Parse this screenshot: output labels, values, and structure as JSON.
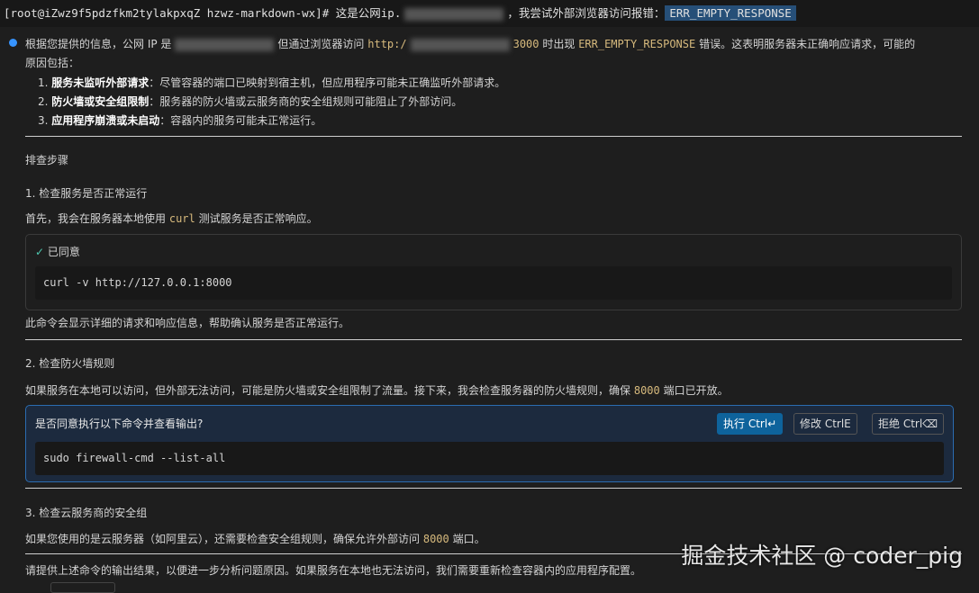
{
  "terminal": {
    "prompt": "[root@iZwz9f5pdzfkm2tylakpxqZ hzwz-markdown-wx]#",
    "text_a": "这是公网ip.",
    "text_b": "，我尝试外部浏览器访问报错：",
    "error": "ERR_EMPTY_RESPONSE"
  },
  "intro": {
    "a": "根据您提供的信息，公网 IP 是",
    "b": "但通过浏览器访问",
    "url_a": "http:/",
    "url_b": "3000",
    "c": "时出现",
    "err": "ERR_EMPTY_RESPONSE",
    "d": "错误。这表明服务器未正确响应请求，可能的",
    "e": "原因包括："
  },
  "reasons": [
    {
      "n": "1.",
      "t": "服务未监听外部请求",
      "d": "：尽管容器的端口已映射到宿主机，但应用程序可能未正确监听外部请求。"
    },
    {
      "n": "2.",
      "t": "防火墙或安全组限制",
      "d": "：服务器的防火墙或云服务商的安全组规则可能阻止了外部访问。"
    },
    {
      "n": "3.",
      "t": "应用程序崩溃或未启动",
      "d": "：容器内的服务可能未正常运行。"
    }
  ],
  "steps_title": "排查步骤",
  "step1": {
    "title": "1. 检查服务是否正常运行",
    "a": "首先，我会在服务器本地使用",
    "code": "curl",
    "b": "测试服务是否正常响应。",
    "approved": "已同意",
    "command": "curl -v http://127.0.0.1:8000",
    "after": "此命令会显示详细的请求和响应信息，帮助确认服务是否正常运行。"
  },
  "step2": {
    "title": "2. 检查防火墙规则",
    "a": "如果服务在本地可以访问，但外部无法访问，可能是防火墙或安全组限制了流量。接下来，我会检查服务器的防火墙规则，确保",
    "port": "8000",
    "b": "端口已开放。",
    "question": "是否同意执行以下命令并查看输出?",
    "run": "执行 Ctrl↵",
    "edit": "修改 CtrlE",
    "reject": "拒绝 Ctrl⌫",
    "command": "sudo firewall-cmd --list-all"
  },
  "step3": {
    "title": "3. 检查云服务商的安全组",
    "a": "如果您使用的是云服务器（如阿里云），还需要检查安全组规则，确保允许外部访问",
    "port": "8000",
    "b": "端口。"
  },
  "closing": "请提供上述命令的输出结果，以便进一步分析问题原因。如果服务在本地也无法访问，我们需要重新检查容器内的应用程序配置。",
  "watermark": "掘金技术社区 @ coder_pig"
}
